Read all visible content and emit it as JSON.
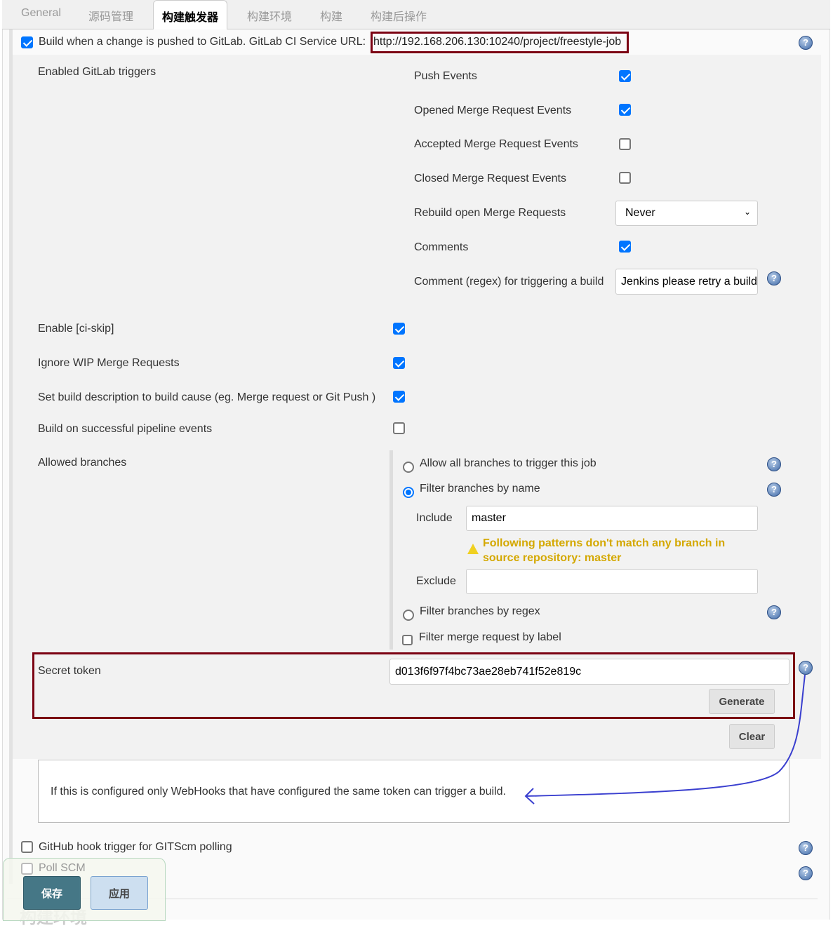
{
  "tabs": [
    "General",
    "源码管理",
    "构建触发器",
    "构建环境",
    "构建",
    "构建后操作"
  ],
  "active_tab": "构建触发器",
  "gitlab": {
    "label": "Build when a change is pushed to GitLab. GitLab CI Service URL:",
    "url": "http://192.168.206.130:10240/project/freestyle-job",
    "checked": true,
    "enabled_triggers_label": "Enabled GitLab triggers",
    "triggers": [
      {
        "label": "Push Events",
        "checked": true
      },
      {
        "label": "Opened Merge Request Events",
        "checked": true
      },
      {
        "label": "Accepted Merge Request Events",
        "checked": false
      },
      {
        "label": "Closed Merge Request Events",
        "checked": false
      }
    ],
    "rebuild_label": "Rebuild open Merge Requests",
    "rebuild_value": "Never",
    "comments_label": "Comments",
    "comments_checked": true,
    "comment_regex_label": "Comment (regex) for triggering a build",
    "comment_regex_value": "Jenkins please retry a build",
    "options": [
      {
        "label": "Enable [ci-skip]",
        "checked": true
      },
      {
        "label": "Ignore WIP Merge Requests",
        "checked": true
      },
      {
        "label": "Set build description to build cause (eg. Merge request or Git Push )",
        "checked": true
      },
      {
        "label": "Build on successful pipeline events",
        "checked": false
      }
    ],
    "allowed_branches_label": "Allowed branches",
    "branch_options": [
      "Allow all branches to trigger this job",
      "Filter branches by name",
      "Filter branches by regex"
    ],
    "selected_branch_option": "Filter branches by name",
    "include_label": "Include",
    "include_value": "master",
    "warning": "Following patterns don't match any branch in source repository: master",
    "exclude_label": "Exclude",
    "exclude_value": "",
    "filter_label": "Filter merge request by label",
    "filter_label_checked": false,
    "secret_token_label": "Secret token",
    "secret_token_value": "d013f6f97f4bc73ae28eb741f52e819c",
    "generate_label": "Generate",
    "clear_label": "Clear",
    "help_text": "If this is configured only WebHooks that have configured the same token can trigger a build."
  },
  "other_triggers": [
    {
      "label": "GitHub hook trigger for GITScm polling",
      "checked": false
    },
    {
      "label": "Poll SCM",
      "checked": false
    }
  ],
  "next_section": "构建环境",
  "footer": {
    "save": "保存",
    "apply": "应用"
  },
  "colors": {
    "highlight": "#7b0012",
    "annotation": "#3a3fcf",
    "warning": "#d4a800",
    "checkbox": "#0075ff"
  }
}
